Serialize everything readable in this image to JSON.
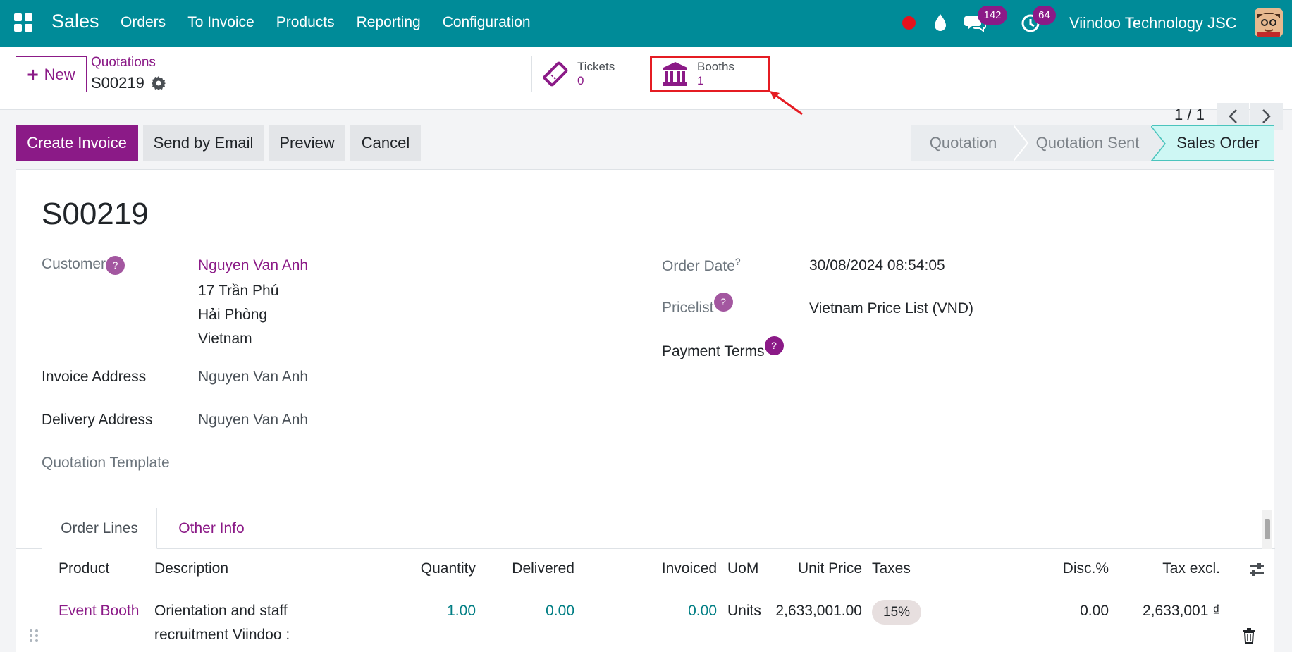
{
  "navbar": {
    "brand": "Sales",
    "menu": [
      "Orders",
      "To Invoice",
      "Products",
      "Reporting",
      "Configuration"
    ],
    "messages_badge": "142",
    "activities_badge": "64",
    "company": "Viindoo Technology JSC"
  },
  "control_panel": {
    "new_label": "New",
    "breadcrumb": "Quotations",
    "record": "S00219",
    "stat_buttons": {
      "tickets": {
        "label": "Tickets",
        "value": "0"
      },
      "booths": {
        "label": "Booths",
        "value": "1"
      }
    },
    "pager": "1 / 1"
  },
  "status_bar": {
    "actions": {
      "create_invoice": "Create Invoice",
      "send_email": "Send by Email",
      "preview": "Preview",
      "cancel": "Cancel"
    },
    "stages": [
      "Quotation",
      "Quotation Sent",
      "Sales Order"
    ],
    "active_stage": "Sales Order"
  },
  "form": {
    "title": "S00219",
    "customer_label": "Customer",
    "customer_name": "Nguyen Van Anh",
    "customer_address": [
      "17 Trần Phú",
      "Hải Phòng",
      "Vietnam"
    ],
    "invoice_address_label": "Invoice Address",
    "invoice_address": "Nguyen Van Anh",
    "delivery_address_label": "Delivery Address",
    "delivery_address": "Nguyen Van Anh",
    "quotation_template_label": "Quotation Template",
    "order_date_label": "Order Date",
    "order_date": "30/08/2024 08:54:05",
    "pricelist_label": "Pricelist",
    "pricelist": "Vietnam Price List (VND)",
    "payment_terms_label": "Payment Terms",
    "help_mark": "?"
  },
  "tabs": [
    "Order Lines",
    "Other Info"
  ],
  "order_lines": {
    "columns": [
      "Product",
      "Description",
      "Quantity",
      "Delivered",
      "Invoiced",
      "UoM",
      "Unit Price",
      "Taxes",
      "Disc.%",
      "Tax excl."
    ],
    "rows": [
      {
        "product": "Event Booth",
        "description_line1": "Orientation and staff",
        "description_line2": "recruitment Viindoo :",
        "quantity": "1.00",
        "delivered": "0.00",
        "invoiced": "0.00",
        "uom": "Units",
        "unit_price": "2,633,001.00",
        "taxes": "15%",
        "discount": "0.00",
        "tax_excl": "2,633,001 ₫"
      }
    ]
  },
  "colors": {
    "navbar": "#008b98",
    "primary": "#8b1a87",
    "active_stage": "#cef7f4",
    "highlight_box": "#e51c23",
    "numeric_link": "#017e84"
  }
}
